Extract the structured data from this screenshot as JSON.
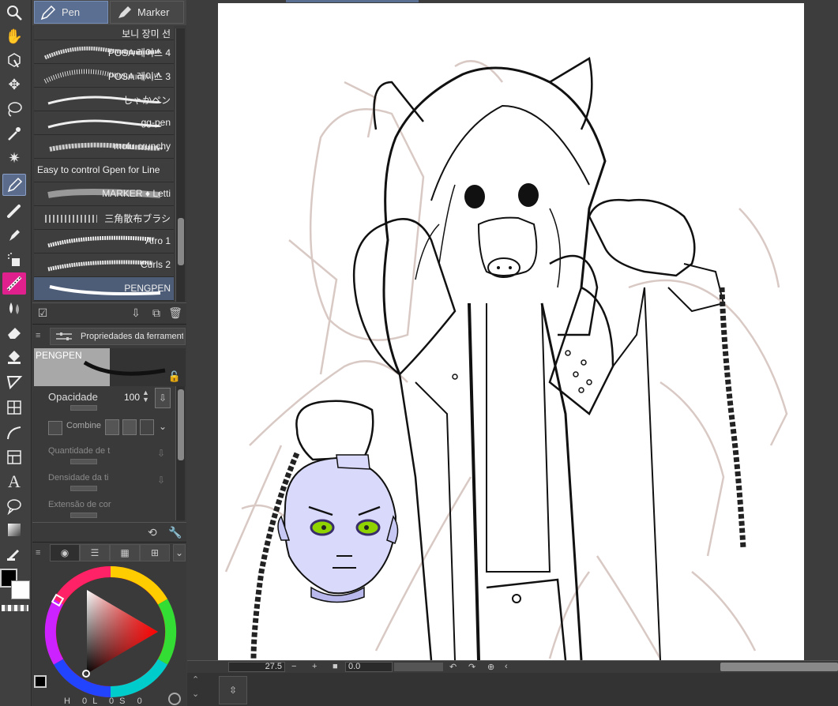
{
  "tabs": {
    "pen": "Pen",
    "marker": "Marker"
  },
  "brushes": [
    "보니 장미 선",
    "POSA 레이스 4",
    "POSA 레이스 3",
    "しゃかペン",
    "gg-pen",
    "mofu crunchy",
    "Easy to control Gpen for Line",
    "MARKER ♦ Letti",
    "三角散布ブラシ",
    "Afro 1",
    "Curls 2",
    "PENGPEN"
  ],
  "selected_brush_index": 11,
  "props": {
    "title": "Propriedades da ferramenta",
    "preview_name": "PENGPEN",
    "opacity_label": "Opacidade",
    "opacity_value": "100",
    "combine_label": "Combine",
    "qty_label": "Quantidade de t",
    "density_label": "Densidade da ti",
    "extent_label": "Extensão de cor"
  },
  "color": {
    "hsl_h": "H",
    "hsl_l": "L",
    "hsl_s": "S",
    "v0": "0",
    "v1": "0",
    "v2": "0",
    "fg": "#000000",
    "bg": "#ffffff"
  },
  "nav": {
    "zoom": "27.5",
    "angle": "0.0",
    "minus": "−",
    "plus": "+"
  },
  "tools": [
    "zoom-icon",
    "hand-icon",
    "object-icon",
    "move-icon",
    "lasso-icon",
    "eyedropper-icon",
    "magic-wand-icon",
    "pen-icon",
    "pencil-icon",
    "brush-icon",
    "airbrush-icon",
    "decoration-icon",
    "blend-icon",
    "eraser-icon",
    "fill-icon",
    "gradient-icon",
    "frame-icon",
    "ruler-icon",
    "curve-icon",
    "text-icon",
    "balloon-icon",
    "layer-icon",
    "color-icon",
    "correction-icon"
  ],
  "text_tool_label": "A"
}
